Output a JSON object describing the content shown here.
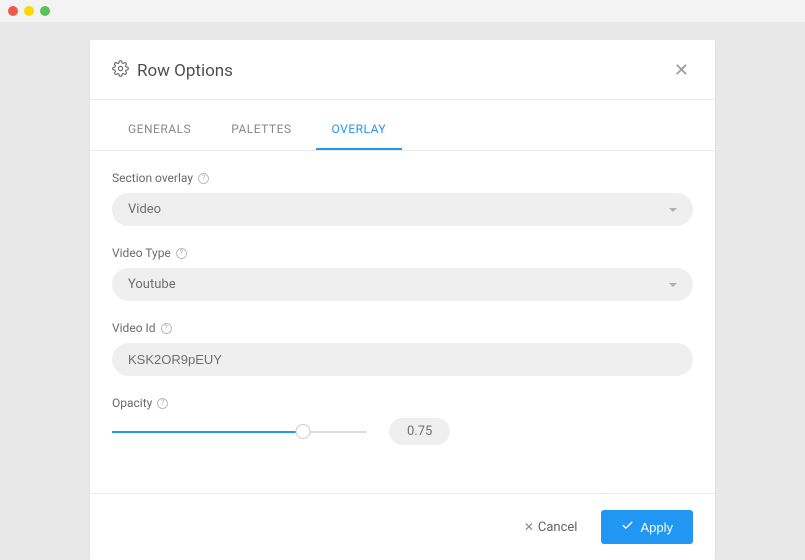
{
  "modal": {
    "title": "Row Options"
  },
  "tabs": [
    {
      "label": "GENERALS",
      "active": false
    },
    {
      "label": "PALETTES",
      "active": false
    },
    {
      "label": "OVERLAY",
      "active": true
    }
  ],
  "fields": {
    "sectionOverlay": {
      "label": "Section overlay",
      "value": "Video"
    },
    "videoType": {
      "label": "Video Type",
      "value": "Youtube"
    },
    "videoId": {
      "label": "Video Id",
      "value": "KSK2OR9pEUY"
    },
    "opacity": {
      "label": "Opacity",
      "value": "0.75",
      "percent": 75
    }
  },
  "buttons": {
    "cancel": "Cancel",
    "apply": "Apply"
  }
}
